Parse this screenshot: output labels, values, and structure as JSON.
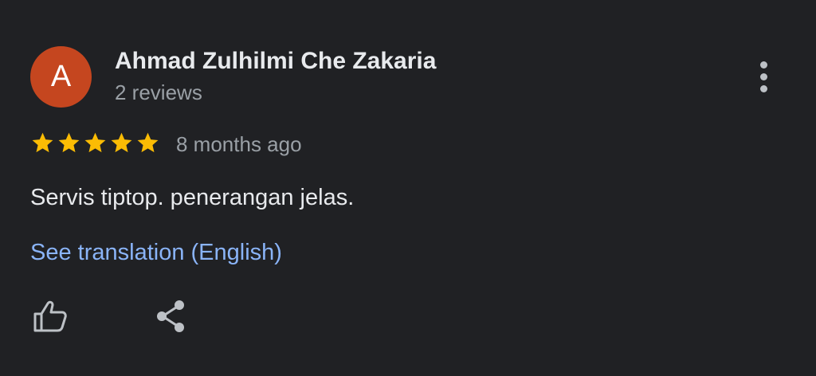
{
  "review": {
    "avatar_initial": "A",
    "avatar_color": "#c5461f",
    "author_name": "Ahmad Zulhilmi Che Zakaria",
    "review_count": "2 reviews",
    "rating": 5,
    "rating_max": 5,
    "time_ago": "8 months ago",
    "text": "Servis tiptop. penerangan jelas.",
    "translate_link": "See translation (English)"
  },
  "icons": {
    "more": "more-vert-icon",
    "star": "star-icon",
    "like": "thumb-up-icon",
    "share": "share-icon"
  },
  "colors": {
    "background": "#202124",
    "star": "#fbbc04",
    "link": "#8ab4f8",
    "secondary_text": "#9aa0a6",
    "primary_text": "#e8eaed"
  }
}
